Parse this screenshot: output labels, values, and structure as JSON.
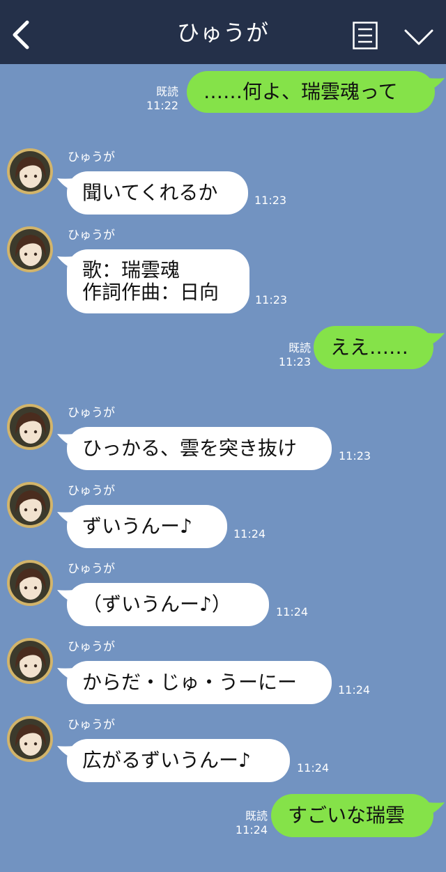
{
  "header": {
    "title": "ひゅうが",
    "back_icon": "chevron-left-icon",
    "menu_icon": "menu-list-icon",
    "collapse_icon": "chevron-down-icon"
  },
  "colors": {
    "background": "#7293c1",
    "header": "#243049",
    "sent_bubble": "#85e249",
    "received_bubble": "#ffffff"
  },
  "messages": [
    {
      "dir": "sent",
      "text": "……何よ、瑞雲魂って",
      "read": "既読",
      "time": "11:22"
    },
    {
      "dir": "received",
      "sender": "ひゅうが",
      "text": "聞いてくれるか",
      "time": "11:23"
    },
    {
      "dir": "received",
      "sender": "ひゅうが",
      "lines": [
        "歌：瑞雲魂",
        "作詞作曲：日向"
      ],
      "time": "11:23"
    },
    {
      "dir": "sent",
      "text": "ええ……",
      "read": "既読",
      "time": "11:23"
    },
    {
      "dir": "received",
      "sender": "ひゅうが",
      "text": "ひっかる、雲を突き抜け",
      "time": "11:23"
    },
    {
      "dir": "received",
      "sender": "ひゅうが",
      "text": "ずいうんー♪",
      "time": "11:24"
    },
    {
      "dir": "received",
      "sender": "ひゅうが",
      "text": "（ずいうんー♪）",
      "time": "11:24"
    },
    {
      "dir": "received",
      "sender": "ひゅうが",
      "text": "からだ・じゅ・うーにー",
      "time": "11:24"
    },
    {
      "dir": "received",
      "sender": "ひゅうが",
      "text": "広がるずいうんー♪",
      "time": "11:24"
    },
    {
      "dir": "sent",
      "text": "すごいな瑞雲",
      "read": "既読",
      "time": "11:24"
    }
  ]
}
